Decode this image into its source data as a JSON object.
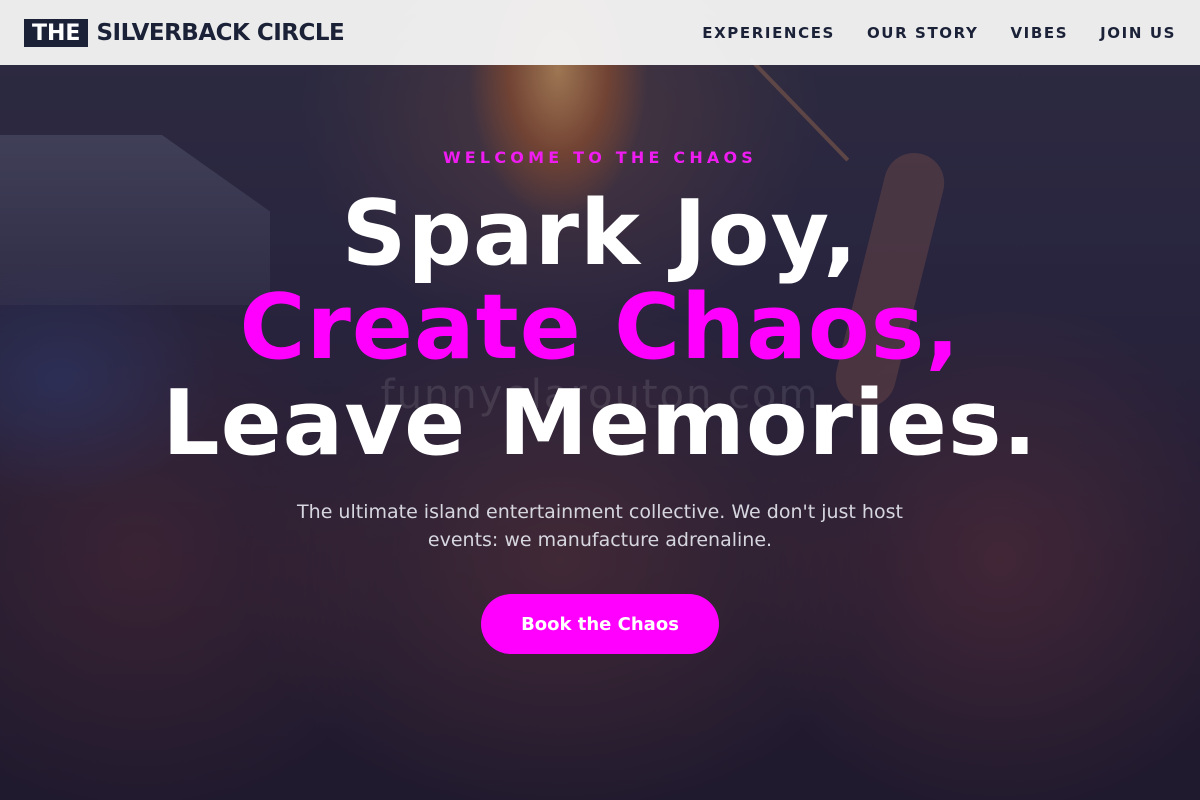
{
  "brand": {
    "badge": "THE",
    "name": "SILVERBACK CIRCLE"
  },
  "nav": {
    "links": [
      "EXPERIENCES",
      "OUR STORY",
      "VIBES",
      "JOIN US"
    ]
  },
  "hero": {
    "eyebrow": "WELCOME TO THE CHAOS",
    "line1": "Spark Joy,",
    "line2": "Create Chaos,",
    "line3": "Leave Memories.",
    "watermark": "funnyolarouton.com",
    "subtitle": "The ultimate island entertainment collective. We don't just host events: we manufacture adrenaline.",
    "cta_label": "Book the Chaos"
  },
  "colors": {
    "accent": "#ff00ff",
    "navy": "#1b2238",
    "nav_bg": "#f4f4f4"
  }
}
